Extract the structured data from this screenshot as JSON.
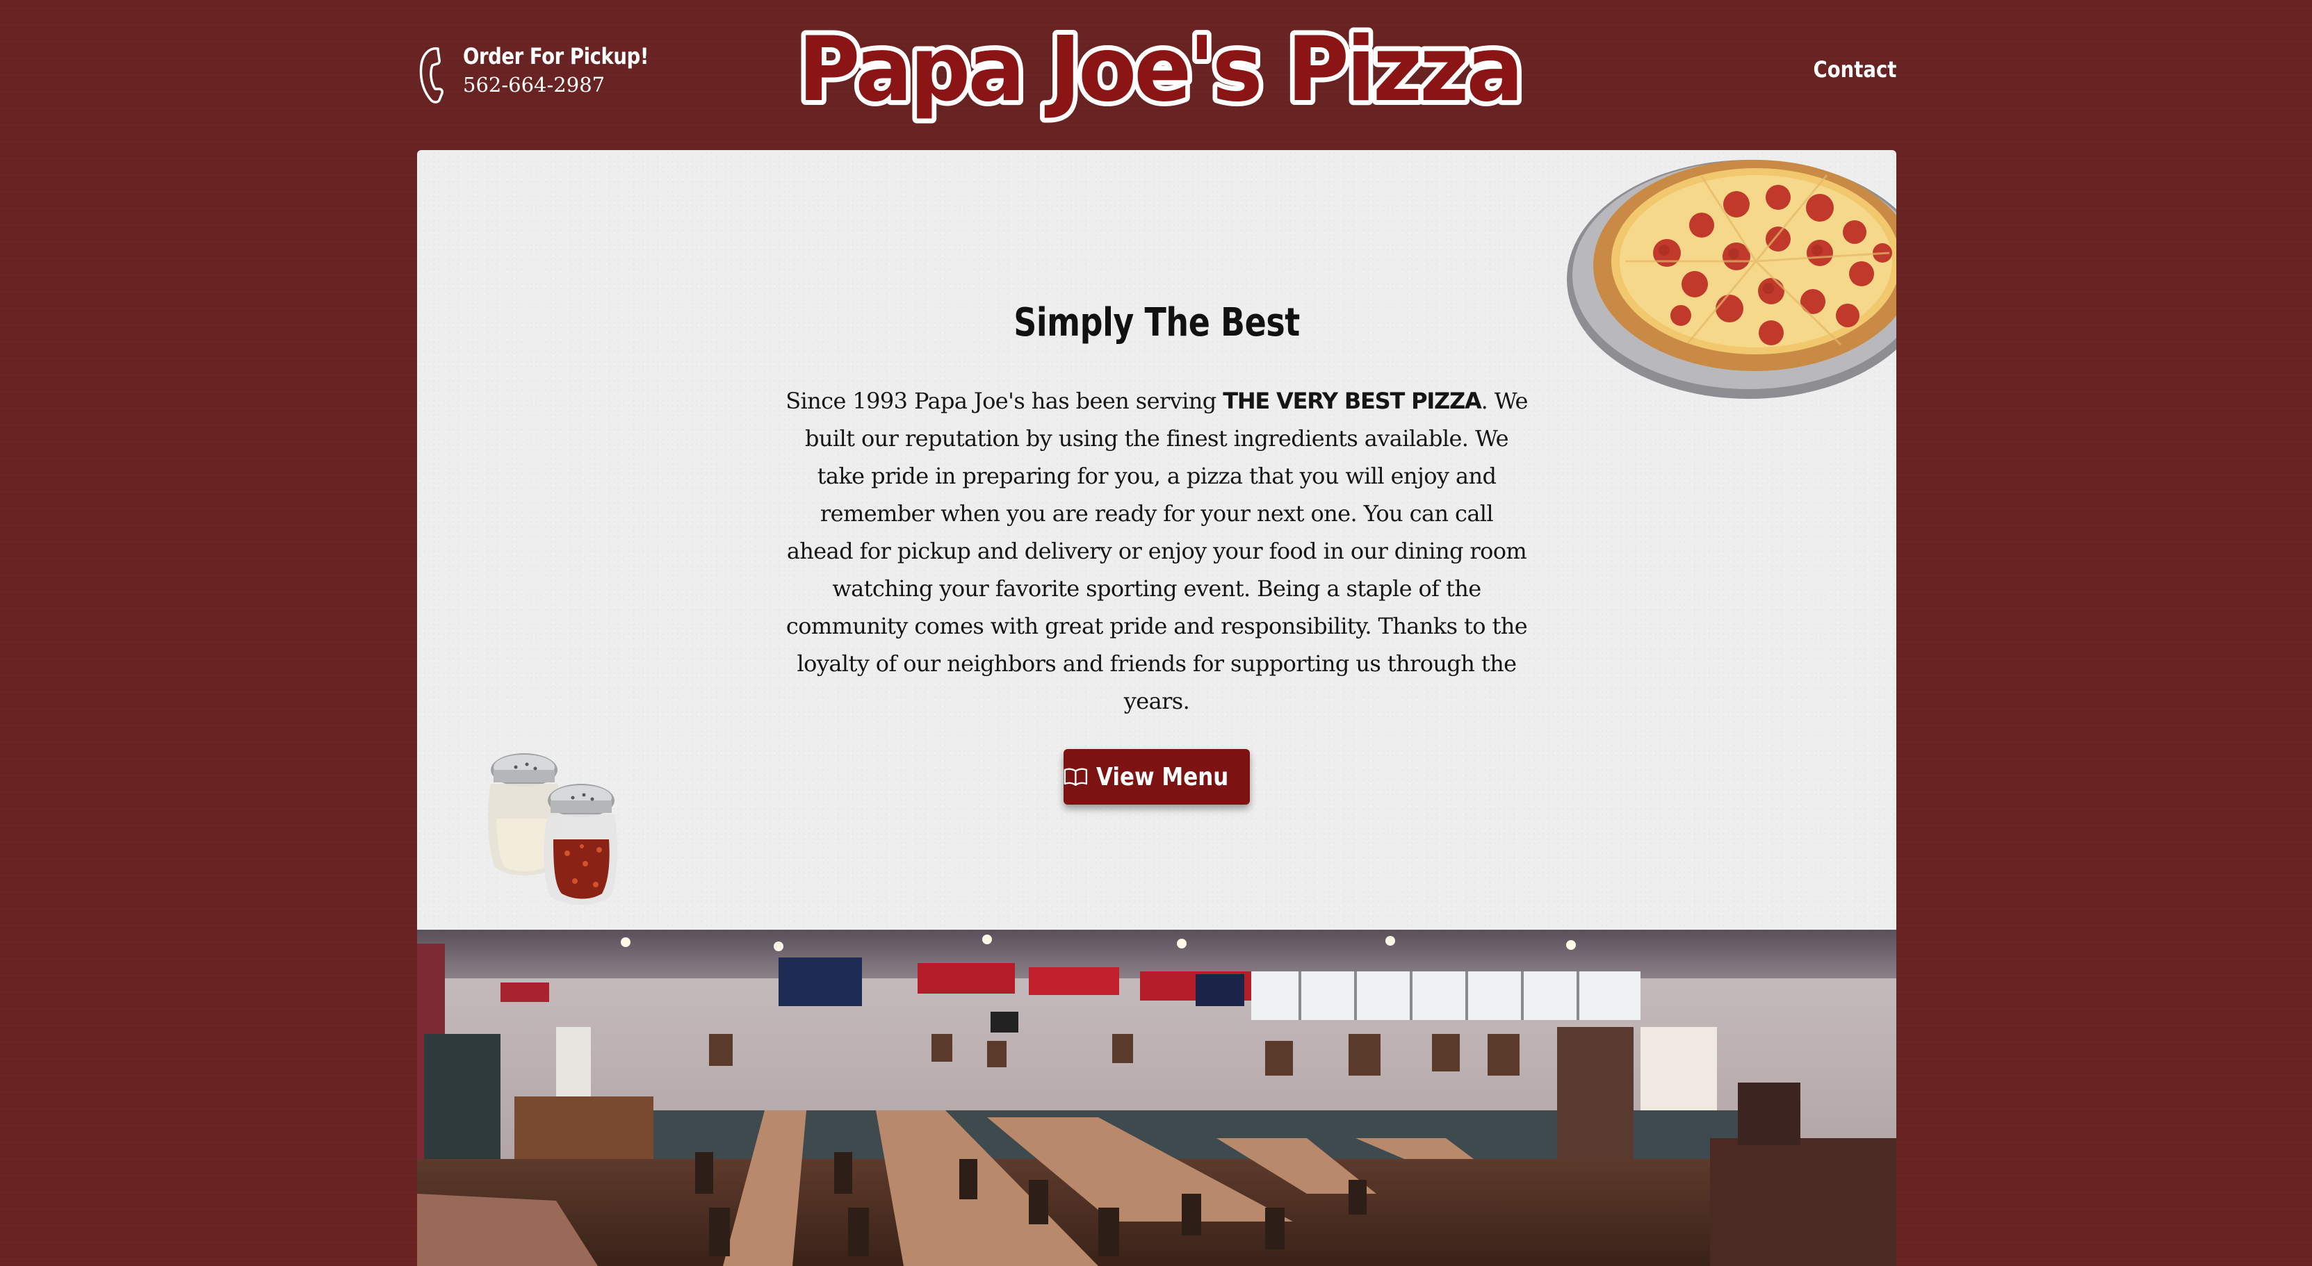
{
  "header": {
    "pickup_title": "Order For Pickup!",
    "pickup_phone": "562-664-2987",
    "logo_text": "Papa Joe's Pizza",
    "nav_contact": "Contact"
  },
  "main": {
    "headline": "Simply The Best",
    "intro_before": "Since 1993 Papa Joe's has been serving ",
    "intro_strong": "THE VERY BEST PIZZA",
    "intro_after": ". We built our reputation by using the finest ingredients available. We take pride in preparing for you, a pizza that you will enjoy and remember when you are ready for your next one. You can call ahead for pickup and delivery or enjoy your food in our dining room watching your favorite sporting event. Being a staple of the community comes with great pride and responsibility. Thanks to the loyalty of our neighbors and friends for supporting us through the years.",
    "menu_button_label": "View Menu",
    "menu_button_icon": "open-book-icon"
  },
  "icons": {
    "phone": "phone-handset-icon",
    "book": "open-book-icon"
  },
  "colors": {
    "page_background": "#6b2424",
    "card_background": "#eeeeee",
    "logo_fill": "#8b1414",
    "button_background": "#7d1212",
    "text_light": "#ffffff",
    "text_dark": "#151515"
  }
}
